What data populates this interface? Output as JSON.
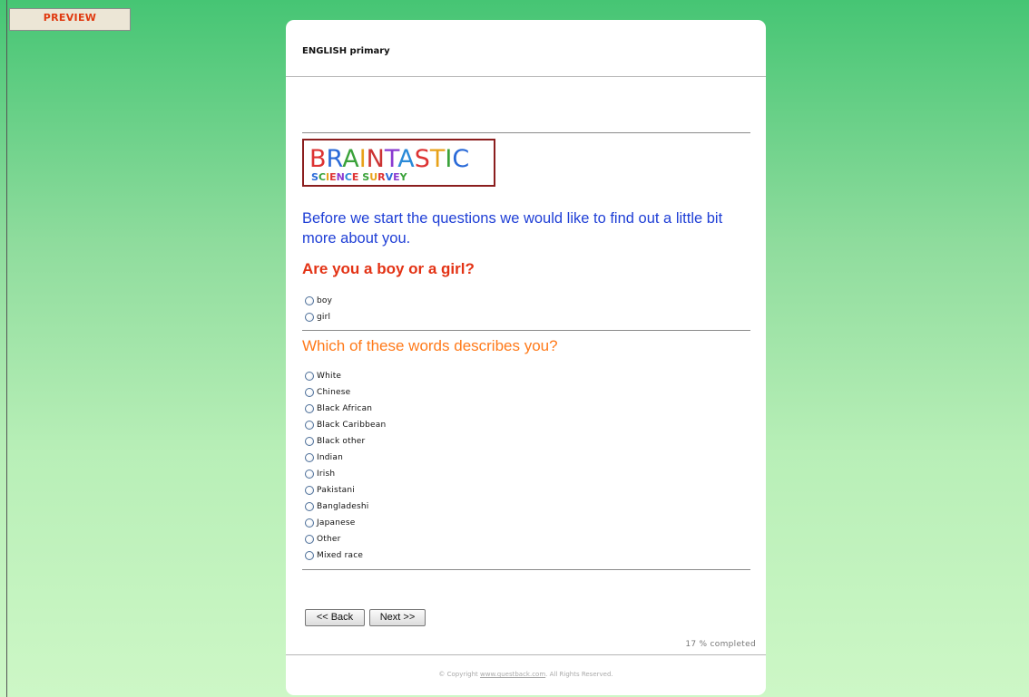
{
  "preview_label": "PREVIEW",
  "survey_name": "ENGLISH primary",
  "logo": {
    "line1": "BRAINTASTIC",
    "line2": "SCIENCE SURVEY"
  },
  "intro_text": "Before we start the questions we would like to find out a little bit more about you.",
  "question1": {
    "text": "Are you a boy or a girl?",
    "options": [
      "boy",
      "girl"
    ]
  },
  "question2": {
    "text": "Which of these words describes you?",
    "options": [
      "White",
      "Chinese",
      "Black African",
      "Black Caribbean",
      "Black other",
      "Indian",
      "Irish",
      "Pakistani",
      "Bangladeshi",
      "Japanese",
      "Other",
      "Mixed race"
    ]
  },
  "nav": {
    "back_label": "<< Back",
    "next_label": "Next >>"
  },
  "progress_text": "17 % completed",
  "footer": {
    "prefix": "© Copyright ",
    "link": "www.questback.com",
    "suffix": ". All Rights Reserved."
  },
  "colors": {
    "intro": "#1f3fd6",
    "question1": "#e33214",
    "question2": "#ff7a1a",
    "preview": "#e03a10"
  }
}
